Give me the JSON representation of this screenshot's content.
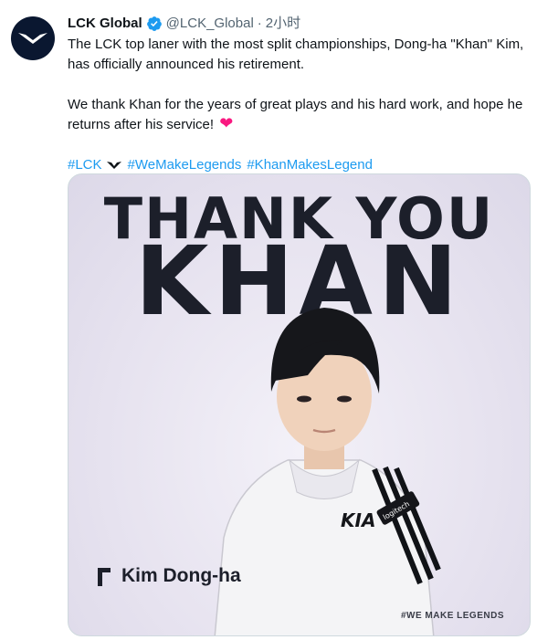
{
  "account": {
    "name": "LCK Global",
    "handle": "@LCK_Global",
    "separator": "·",
    "time": "2小时",
    "avatar_icon": "lck-logo-icon",
    "verified_icon": "verified-badge-icon"
  },
  "tweet": {
    "paragraph1": "The LCK top laner with the most split championships, Dong-ha \"Khan\" Kim, has officially announced his retirement.",
    "paragraph2": "We thank Khan for the years of great plays and his hard work, and hope he returns after his service!",
    "heart": "❤",
    "hashtags": [
      "#LCK",
      "#WeMakeLegends",
      "#KhanMakesLegend"
    ]
  },
  "media": {
    "headline1": "THANK YOU",
    "headline2": "KHAN",
    "player_name": "Kim Dong-ha",
    "footer": "#WE MAKE LEGENDS",
    "jacket_brand": "KIA",
    "jacket_logo": "logitech",
    "colors": {
      "background": "#e6e2ef",
      "text_dark": "#1c1f2a"
    }
  },
  "colors": {
    "link": "#1d9bf0",
    "verified": "#1d9bf0",
    "muted": "#536471",
    "heart": "#f91880"
  }
}
